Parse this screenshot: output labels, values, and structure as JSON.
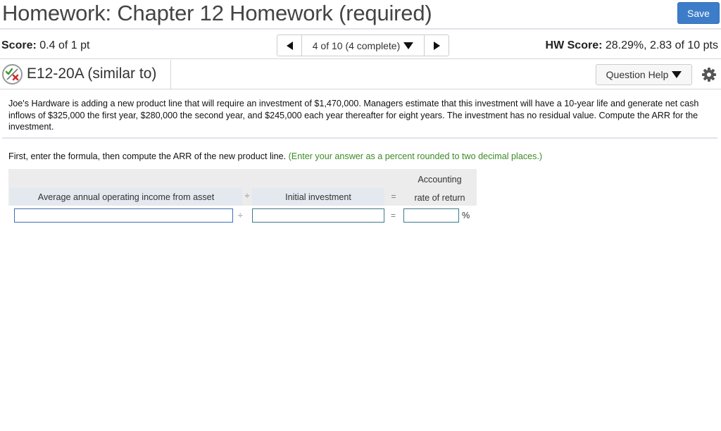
{
  "header": {
    "title": "Homework: Chapter 12 Homework (required)",
    "save_label": "Save"
  },
  "score_row": {
    "score_label": "Score:",
    "score_value": "0.4 of 1 pt",
    "navigator": {
      "prev_icon": "triangle-left-icon",
      "position_text": "4 of 10 (4 complete)",
      "dropdown_icon": "triangle-down-icon",
      "next_icon": "triangle-right-icon"
    },
    "hw_score_label": "HW Score:",
    "hw_score_value": "28.29%, 2.83 of 10 pts"
  },
  "question": {
    "status_icon": "partial-credit-icon",
    "title": "E12-20A (similar to)",
    "help_label": "Question Help",
    "settings_icon": "gear-icon"
  },
  "problem": {
    "text": "Joe's Hardware is adding a new product line that will require an investment of $1,470,000. Managers estimate that this investment will have a 10-year life and generate net cash inflows of $325,000 the first year, $280,000 the second year, and $245,000 each year thereafter for eight years. The investment has no residual value. Compute the ARR for the investment.",
    "instruction": "First, enter the formula, then compute the ARR of the new product line.",
    "hint": "(Enter your answer as a percent rounded to two decimal places.)"
  },
  "formula": {
    "col1_header": "Average annual operating income from asset",
    "op1": "÷",
    "col2_header": "Initial investment",
    "op2": "=",
    "col3_header_line1": "Accounting",
    "col3_header_line2": "rate of return",
    "input1_value": "",
    "input2_value": "",
    "input3_value": "",
    "unit": "%"
  },
  "colors": {
    "save_button": "#3d7cc9",
    "hint_green": "#3d8a27",
    "header_cell": "#e4e8ef"
  }
}
